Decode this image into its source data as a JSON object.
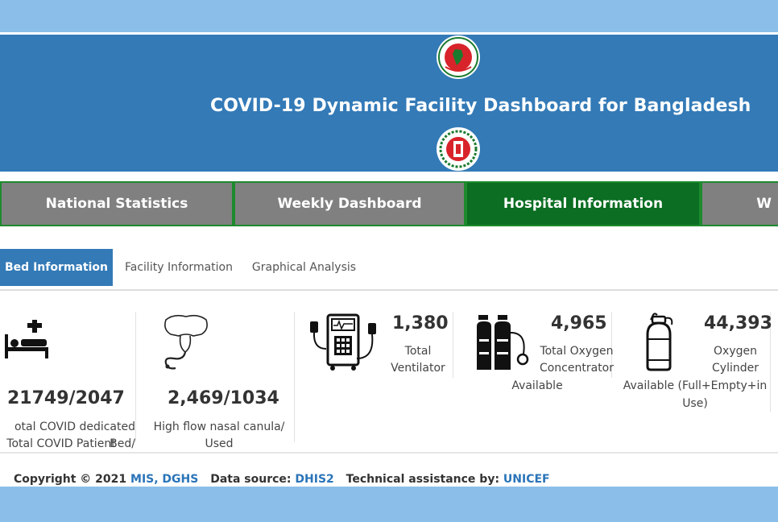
{
  "header": {
    "title": "COVID-19 Dynamic Facility Dashboard for Bangladesh"
  },
  "nav": {
    "tabs": [
      {
        "label": "National Statistics",
        "active": false
      },
      {
        "label": "Weekly Dashboard",
        "active": false
      },
      {
        "label": "Hospital Information",
        "active": true
      },
      {
        "label": "W",
        "active": false
      }
    ]
  },
  "subtabs": [
    {
      "label": "Bed Information",
      "active": true
    },
    {
      "label": "Facility Information",
      "active": false
    },
    {
      "label": "Graphical Analysis",
      "active": false
    }
  ],
  "cards": {
    "beds": {
      "value": "21749/2047",
      "label_line1": "otal COVID dedicated Bed/",
      "label_line2": "Total COVID Patient",
      "icon": "hospital-bed-icon"
    },
    "canula": {
      "value": "2,469/1034",
      "label": "High flow nasal canula/ Used",
      "icon": "nasal-canula-icon"
    },
    "ventilator": {
      "value": "1,380",
      "label_line1": "Total",
      "label_line2": "Ventilator",
      "icon": "ventilator-icon"
    },
    "concentrator": {
      "value": "4,965",
      "label_line1": "Total Oxygen",
      "label_line2": "Concentrator",
      "label_line3": "Available",
      "icon": "oxygen-tanks-icon"
    },
    "cylinder": {
      "value": "44,393",
      "label_line1": "Oxygen",
      "label_line2": "Cylinder",
      "label_line3": "Available (Full+Empty+in",
      "label_line4": "Use)",
      "icon": "oxygen-cylinder-icon"
    }
  },
  "footer": {
    "copyright": "Copyright © 2021",
    "org": "MIS, DGHS",
    "source_label": "Data source:",
    "source": "DHIS2",
    "assist_label": "Technical assistance by:",
    "assist": "UNICEF"
  },
  "colors": {
    "header_bg": "#337ab7",
    "nav_grey": "#808080",
    "nav_active": "#0b6e22",
    "nav_border": "#1e8a2e",
    "link": "#2a74b8",
    "page_band": "#8bbfe9"
  }
}
